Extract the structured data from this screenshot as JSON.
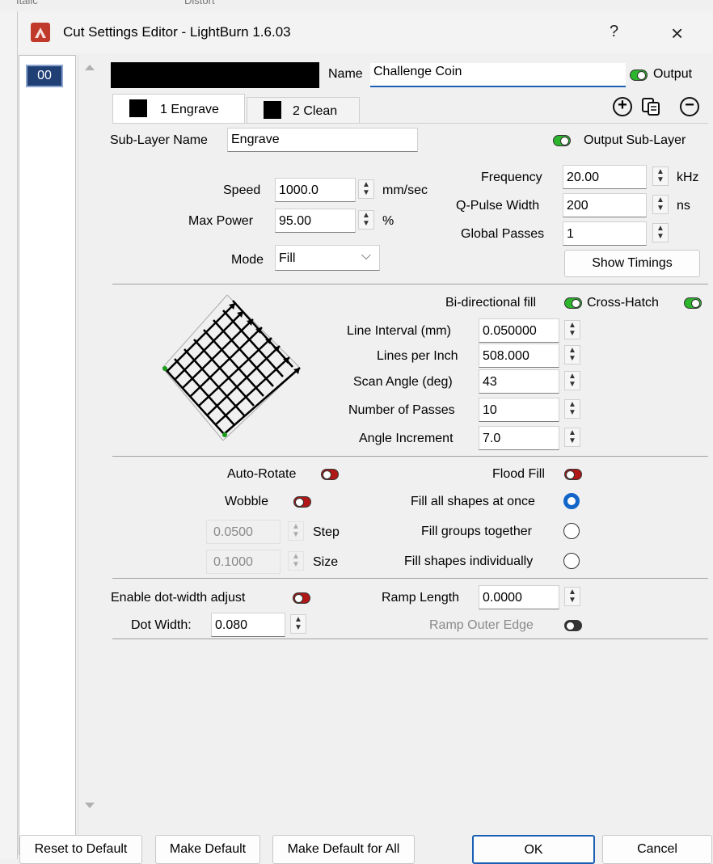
{
  "background_strip": {
    "left_text": "Italic",
    "right_text": "Distort"
  },
  "window": {
    "title": "Cut Settings Editor - LightBurn 1.6.03",
    "help_label": "?",
    "close_label": "×"
  },
  "layers": {
    "items": [
      "00"
    ]
  },
  "header": {
    "name_label": "Name",
    "name_value": "Challenge Coin",
    "output_label": "Output"
  },
  "tabs": [
    {
      "label": "1 Engrave"
    },
    {
      "label": "2 Clean"
    }
  ],
  "sublayer": {
    "name_label": "Sub-Layer Name",
    "name_value": "Engrave",
    "output_label": "Output Sub-Layer"
  },
  "speed": {
    "label": "Speed",
    "value": "1000.0",
    "unit": "mm/sec"
  },
  "max_power": {
    "label": "Max Power",
    "value": "95.00",
    "unit": "%"
  },
  "mode": {
    "label": "Mode",
    "value": "Fill"
  },
  "frequency": {
    "label": "Frequency",
    "value": "20.00",
    "unit": "kHz"
  },
  "qpulse": {
    "label": "Q-Pulse Width",
    "value": "200",
    "unit": "ns"
  },
  "global_passes": {
    "label": "Global Passes",
    "value": "1"
  },
  "show_timings_label": "Show Timings",
  "fill": {
    "bidir_label": "Bi-directional fill",
    "crosshatch_label": "Cross-Hatch",
    "line_interval": {
      "label": "Line Interval (mm)",
      "value": "0.050000"
    },
    "lpi": {
      "label": "Lines per Inch",
      "value": "508.000"
    },
    "scan_angle": {
      "label": "Scan Angle (deg)",
      "value": "43"
    },
    "num_passes": {
      "label": "Number of Passes",
      "value": "10"
    },
    "angle_increment": {
      "label": "Angle Increment",
      "value": "7.0"
    }
  },
  "options": {
    "auto_rotate_label": "Auto-Rotate",
    "flood_fill_label": "Flood Fill",
    "wobble_label": "Wobble",
    "step_value": "0.0500",
    "step_label": "Step",
    "size_value": "0.1000",
    "size_label": "Size",
    "fill_all_label": "Fill all shapes at once",
    "fill_groups_label": "Fill groups together",
    "fill_individual_label": "Fill shapes individually"
  },
  "dot": {
    "enable_label": "Enable dot-width adjust",
    "dot_width_label": "Dot Width:",
    "dot_width_value": "0.080",
    "ramp_length_label": "Ramp Length",
    "ramp_length_value": "0.0000",
    "ramp_outer_label": "Ramp Outer Edge"
  },
  "footer": {
    "reset_label": "Reset to Default",
    "make_default_label": "Make Default",
    "make_default_all_label": "Make Default for All",
    "ok_label": "OK",
    "cancel_label": "Cancel"
  }
}
